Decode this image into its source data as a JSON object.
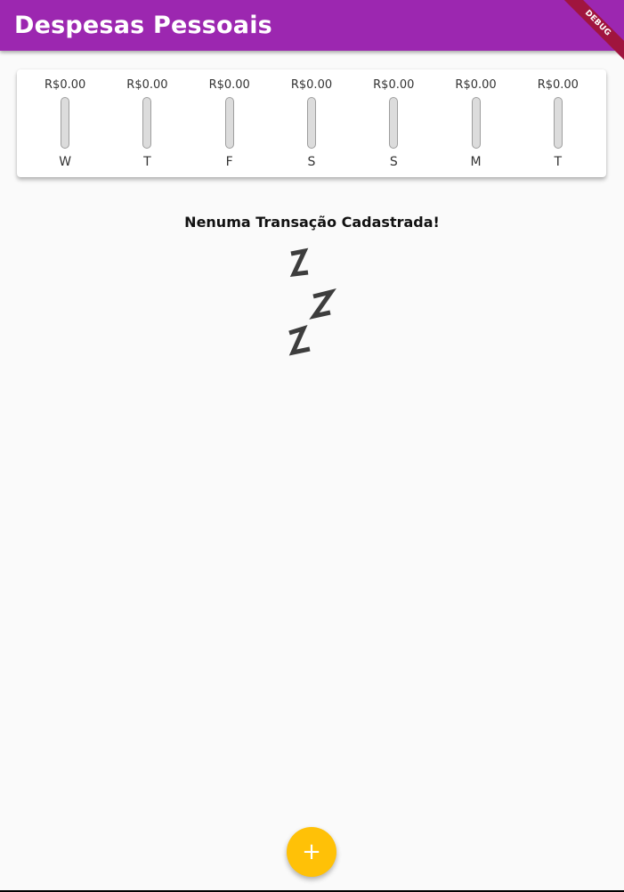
{
  "app_bar": {
    "title": "Despesas Pessoais",
    "color": "#9c27b0"
  },
  "debug_banner": "DEBUG",
  "chart": {
    "bars": [
      {
        "day": "W",
        "value_label": "R$0.00",
        "fill_fraction": 0
      },
      {
        "day": "T",
        "value_label": "R$0.00",
        "fill_fraction": 0
      },
      {
        "day": "F",
        "value_label": "R$0.00",
        "fill_fraction": 0
      },
      {
        "day": "S",
        "value_label": "R$0.00",
        "fill_fraction": 0
      },
      {
        "day": "S",
        "value_label": "R$0.00",
        "fill_fraction": 0
      },
      {
        "day": "M",
        "value_label": "R$0.00",
        "fill_fraction": 0
      },
      {
        "day": "T",
        "value_label": "R$0.00",
        "fill_fraction": 0
      }
    ]
  },
  "empty_state": {
    "title": "Nenuma Transação Cadastrada!",
    "image": "sleeping-zzz-image"
  },
  "fab": {
    "icon": "plus-icon",
    "color": "#ffc107",
    "glyph": "+"
  }
}
